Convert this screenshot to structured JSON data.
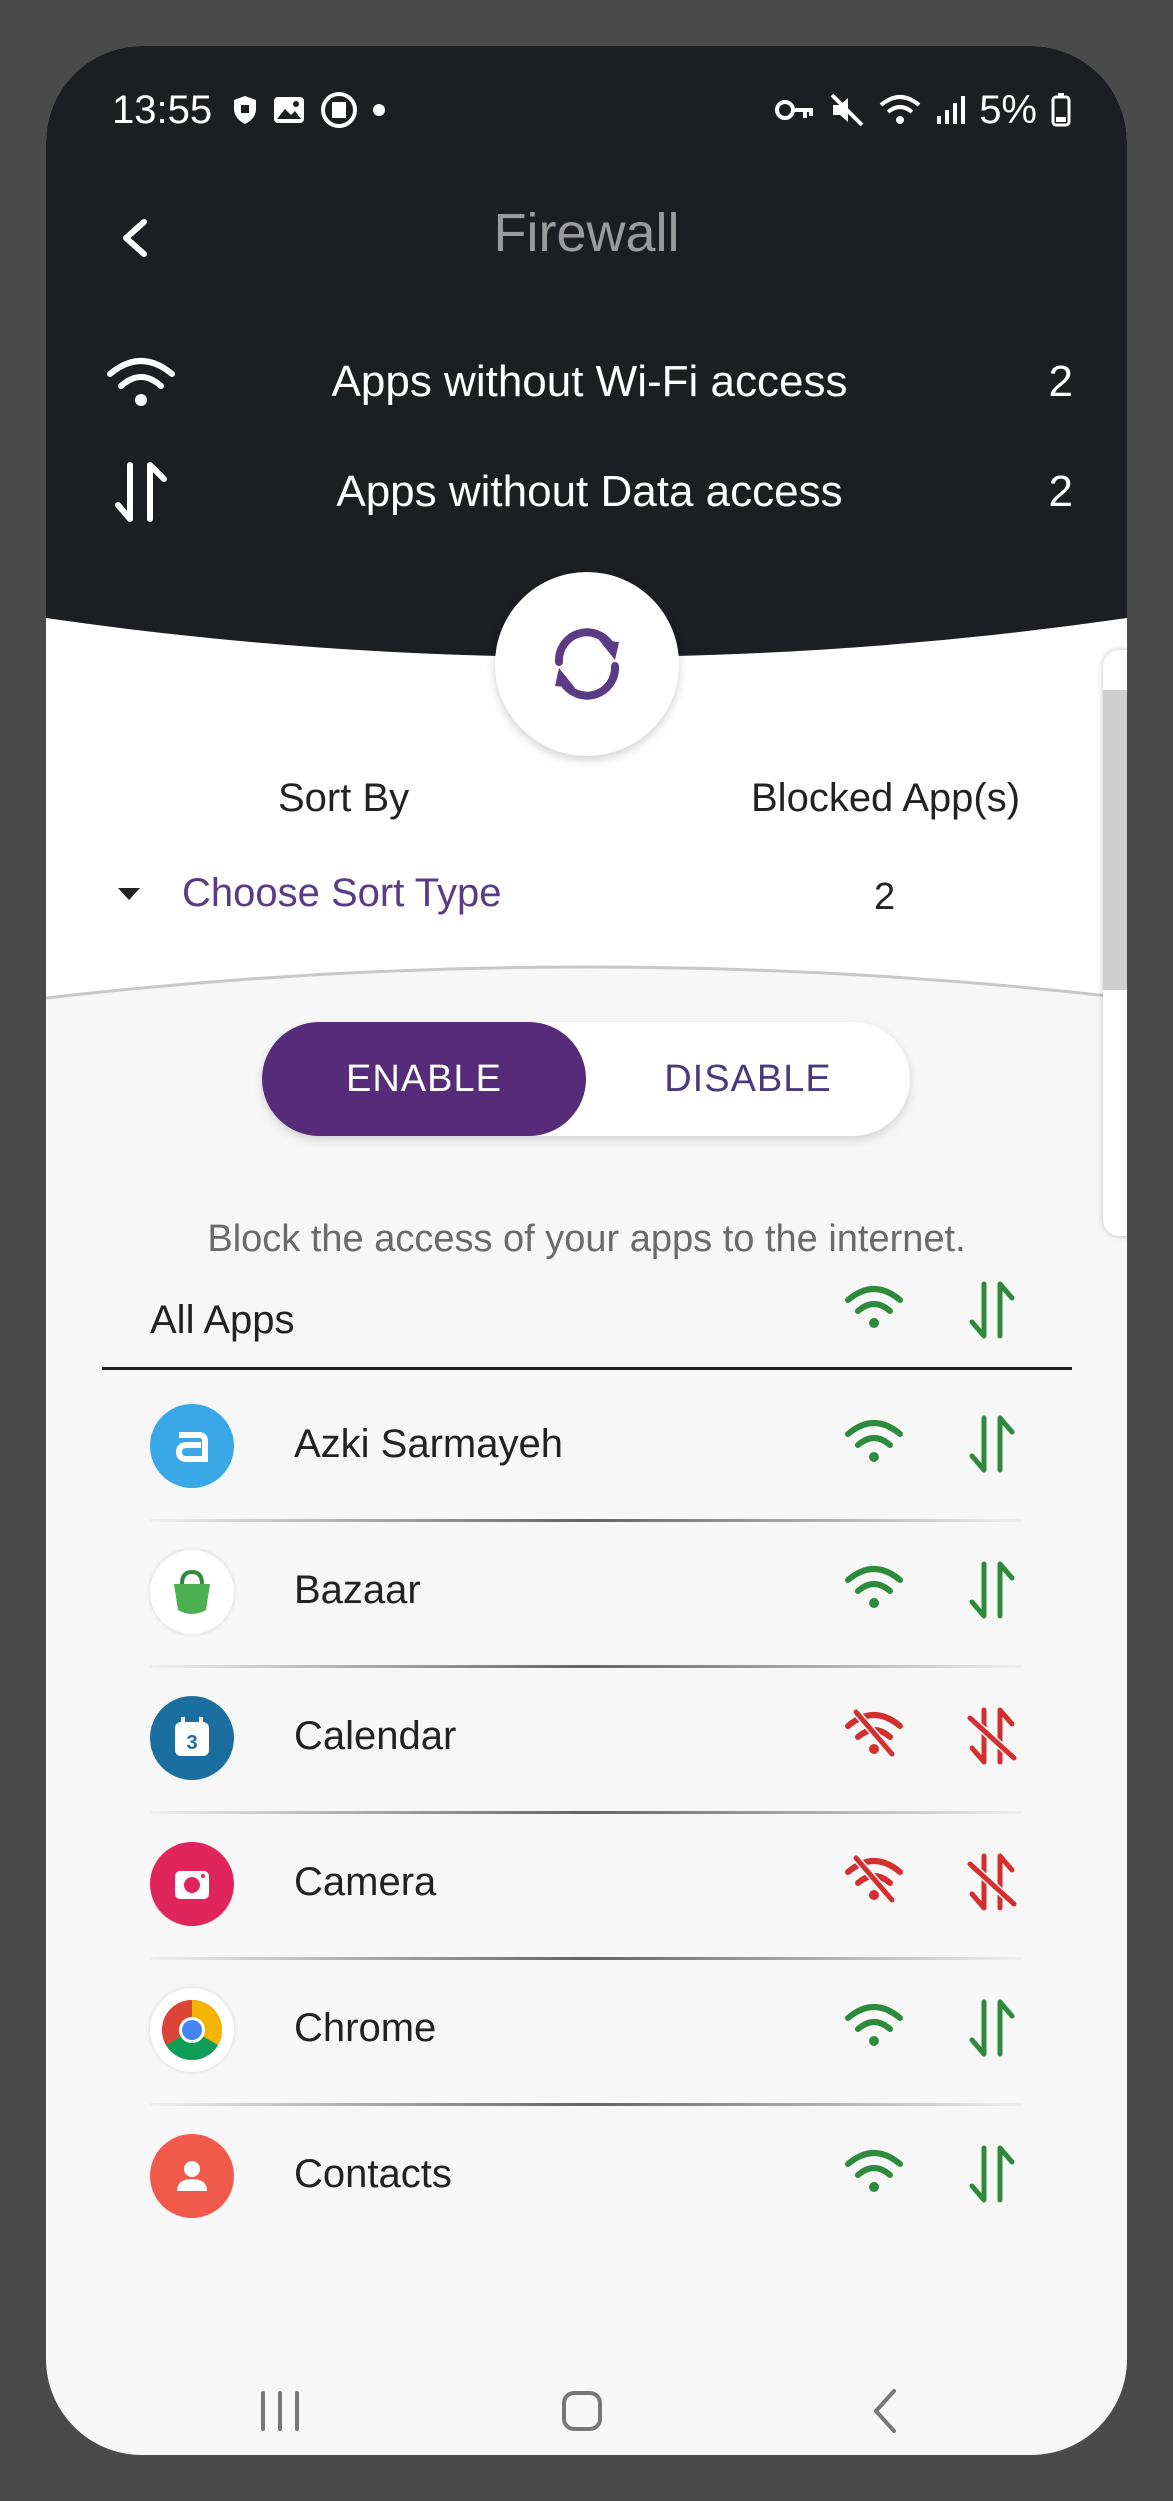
{
  "status_bar": {
    "time": "13:55",
    "battery": "5%"
  },
  "header": {
    "title": "Firewall"
  },
  "stats": [
    {
      "label": "Apps without Wi-Fi access",
      "count": "2",
      "icon": "wifi-icon"
    },
    {
      "label": "Apps without Data access",
      "count": "2",
      "icon": "data-arrows-icon"
    }
  ],
  "sort": {
    "label": "Sort By",
    "placeholder": "Choose Sort Type"
  },
  "blocked": {
    "label": "Blocked App(s)",
    "count": "2"
  },
  "toggle": {
    "enable": "ENABLE",
    "disable": "DISABLE",
    "selected": "ENABLE"
  },
  "hint": "Block the access of your apps to the internet.",
  "all_apps": {
    "label": "All Apps"
  },
  "apps": [
    {
      "name": "Azki Sarmayeh",
      "wifi_allowed": true,
      "data_allowed": true,
      "icon": "azki-icon"
    },
    {
      "name": "Bazaar",
      "wifi_allowed": true,
      "data_allowed": true,
      "icon": "bazaar-icon"
    },
    {
      "name": "Calendar",
      "wifi_allowed": false,
      "data_allowed": false,
      "icon": "calendar-icon"
    },
    {
      "name": "Camera",
      "wifi_allowed": false,
      "data_allowed": false,
      "icon": "camera-icon"
    },
    {
      "name": "Chrome",
      "wifi_allowed": true,
      "data_allowed": true,
      "icon": "chrome-icon"
    },
    {
      "name": "Contacts",
      "wifi_allowed": true,
      "data_allowed": true,
      "icon": "contacts-icon"
    }
  ],
  "colors": {
    "allowed": "#2e8b3d",
    "blocked": "#d32f2f",
    "accent": "#562b7a",
    "header_bg": "#1d1e21"
  }
}
